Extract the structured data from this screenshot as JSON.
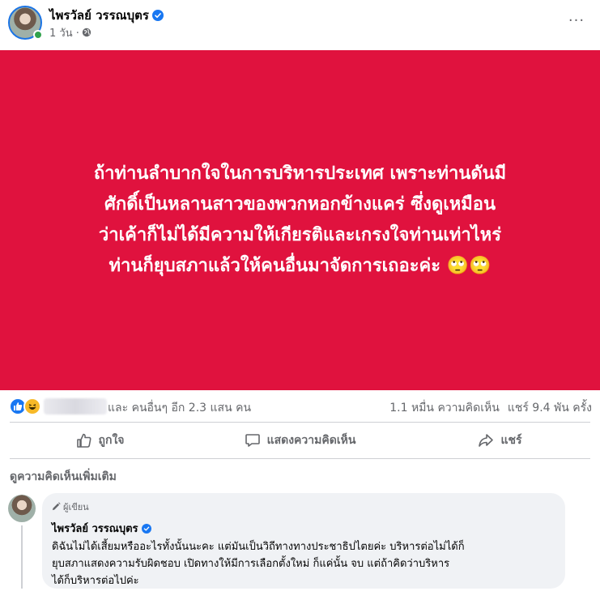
{
  "post": {
    "author": "ไพรวัลย์ วรรณบุตร",
    "time": "1 วัน ·",
    "more": "···",
    "banner_lines": [
      "ถ้าท่านลำบากใจในการบริหารประเทศ  เพราะท่านดันมี",
      "ศักดิ์เป็นหลานสาวของพวกหอกข้างแคร่   ซึ่งดูเหมือน",
      "ว่าเค้าก็ไม่ได้มีความให้เกียรติและเกรงใจท่านเท่าไหร่",
      "ท่านก็ยุบสภาแล้วให้คนอื่นมาจัดการเถอะค่ะ 🙄🙄"
    ],
    "banner_color": "#e0123e"
  },
  "reactions": {
    "icons": [
      "like-icon",
      "haha-icon"
    ],
    "count_text": "และ คนอื่นๆ อีก 2.3 แสน คน",
    "comments": "1.1 หมื่น ความคิดเห็น",
    "shares": "แชร์ 9.4 พัน ครั้ง"
  },
  "actions": {
    "like": "ถูกใจ",
    "comment": "แสดงความคิดเห็น",
    "share": "แชร์"
  },
  "more_comments": "ดูความคิดเห็นเพิ่มเติม",
  "comment": {
    "badge": "ผู้เขียน",
    "author": "ไพรวัลย์ วรรณบุตร",
    "lines": [
      "ดิฉันไม่ได้เสี้ยมหรืออะไรทั้งนั้นนะคะ แต่มันเป็นวิถีทางทางประชาธิปไตยค่ะ บริหารต่อไม่ได้ก็",
      "ยุบสภาแสดงความรับผิดชอบ เปิดทางให้มีการเลือกตั้งใหม่ ก็แค่นั้น จบ  แต่ถ้าคิดว่าบริหาร",
      "ได้ก็บริหารต่อไปค่ะ"
    ]
  },
  "colors": {
    "accent": "#1877f2",
    "muted": "#65676b",
    "comment_bg": "#f0f2f5"
  }
}
